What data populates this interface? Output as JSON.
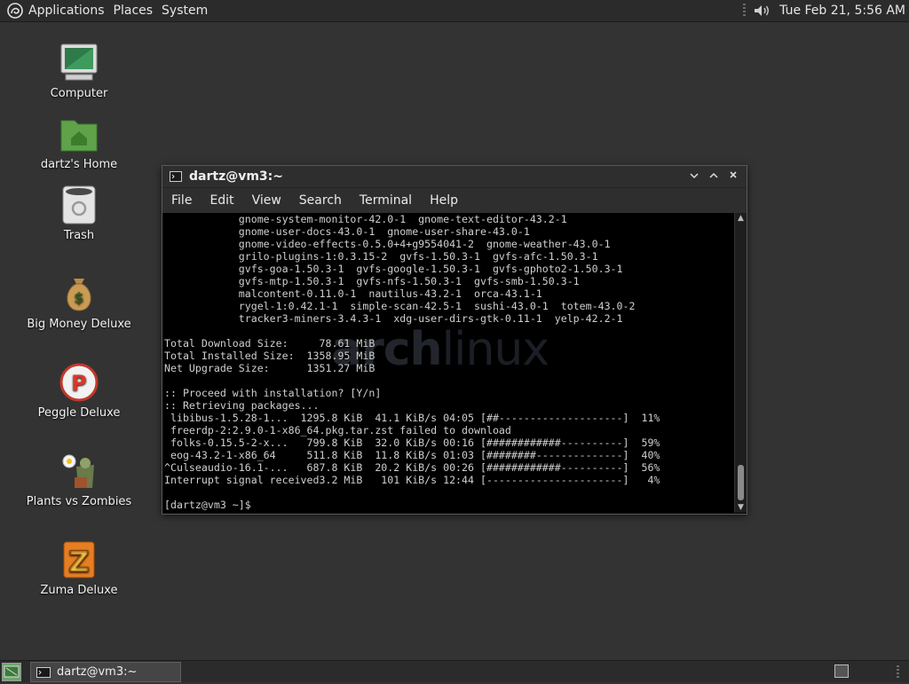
{
  "top_panel": {
    "menus": [
      "Applications",
      "Places",
      "System"
    ],
    "clock": "Tue Feb 21,  5:56 AM"
  },
  "desktop_icons": [
    {
      "label": "Computer",
      "icon": "computer-icon"
    },
    {
      "label": "dartz's Home",
      "icon": "home-folder-icon"
    },
    {
      "label": "Trash",
      "icon": "trash-icon"
    },
    {
      "label": "Big Money Deluxe",
      "icon": "money-bag-icon"
    },
    {
      "label": "Peggle Deluxe",
      "icon": "peggle-icon"
    },
    {
      "label": "Plants vs Zombies",
      "icon": "plants-zombies-icon"
    },
    {
      "label": "Zuma Deluxe",
      "icon": "zuma-icon"
    }
  ],
  "terminal": {
    "title": "dartz@vm3:~",
    "menus": [
      "File",
      "Edit",
      "View",
      "Search",
      "Terminal",
      "Help"
    ],
    "watermark": [
      "arch",
      "linux"
    ],
    "lines": [
      "            gnome-system-monitor-42.0-1  gnome-text-editor-43.2-1",
      "            gnome-user-docs-43.0-1  gnome-user-share-43.0-1",
      "            gnome-video-effects-0.5.0+4+g9554041-2  gnome-weather-43.0-1",
      "            grilo-plugins-1:0.3.15-2  gvfs-1.50.3-1  gvfs-afc-1.50.3-1",
      "            gvfs-goa-1.50.3-1  gvfs-google-1.50.3-1  gvfs-gphoto2-1.50.3-1",
      "            gvfs-mtp-1.50.3-1  gvfs-nfs-1.50.3-1  gvfs-smb-1.50.3-1",
      "            malcontent-0.11.0-1  nautilus-43.2-1  orca-43.1-1",
      "            rygel-1:0.42.1-1  simple-scan-42.5-1  sushi-43.0-1  totem-43.0-2",
      "            tracker3-miners-3.4.3-1  xdg-user-dirs-gtk-0.11-1  yelp-42.2-1",
      "",
      "Total Download Size:     78.61 MiB",
      "Total Installed Size:  1358.95 MiB",
      "Net Upgrade Size:      1351.27 MiB",
      "",
      ":: Proceed with installation? [Y/n]",
      ":: Retrieving packages...",
      " libibus-1.5.28-1...  1295.8 KiB  41.1 KiB/s 04:05 [##--------------------]  11%",
      " freerdp-2:2.9.0-1-x86_64.pkg.tar.zst failed to download",
      " folks-0.15.5-2-x...   799.8 KiB  32.0 KiB/s 00:16 [############----------]  59%",
      " eog-43.2-1-x86_64     511.8 KiB  11.8 KiB/s 01:03 [########--------------]  40%",
      "^Culseaudio-16.1-...   687.8 KiB  20.2 KiB/s 00:26 [############----------]  56%",
      "Interrupt signal received3.2 MiB   101 KiB/s 12:44 [----------------------]   4%",
      "",
      "[dartz@vm3 ~]$"
    ]
  },
  "bottom_panel": {
    "task_title": "dartz@vm3:~"
  }
}
